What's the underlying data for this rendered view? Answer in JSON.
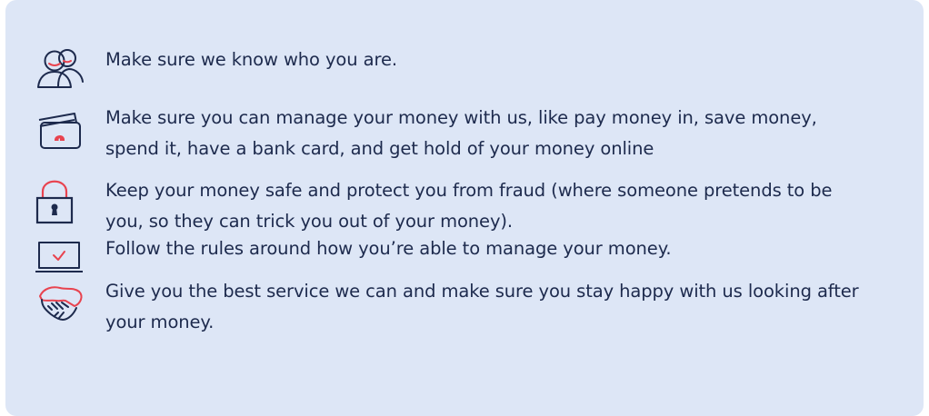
{
  "info_list": {
    "items": [
      {
        "icon": "people-icon",
        "text": "Make sure we know who you are."
      },
      {
        "icon": "bank-card-icon",
        "text": "Make sure you can manage your money with us, like pay money in, save money, spend it, have a bank card, and get hold of your money online"
      },
      {
        "icon": "padlock-icon",
        "text": "Keep your money safe and protect you from fraud (where someone pretends to be you, so they can trick you out of your money)."
      },
      {
        "icon": "laptop-check-icon",
        "text": "Follow the rules around how you’re able to manage your money."
      },
      {
        "icon": "handshake-icon",
        "text": "Give you the best service we can and make sure you stay happy with us looking after your money."
      }
    ]
  },
  "colors": {
    "background": "#dde6f6",
    "text": "#1d2a4d",
    "icon_navy": "#1d2a4d",
    "icon_accent": "#e8434f"
  }
}
